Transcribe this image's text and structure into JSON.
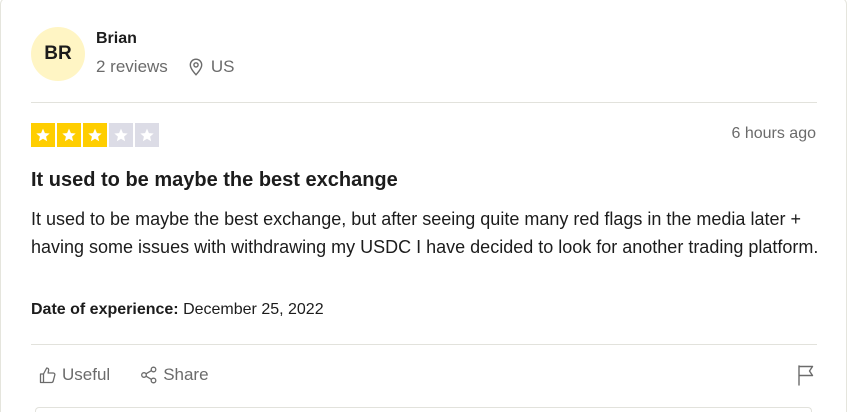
{
  "reviewer": {
    "initials": "BR",
    "name": "Brian",
    "reviews_count": "2 reviews",
    "country": "US",
    "avatar_color": "#fff5c4"
  },
  "review": {
    "rating": 3,
    "rating_max": 5,
    "star_on_color": "#ffce00",
    "star_off_color": "#dcdce6",
    "time_ago": "6 hours ago",
    "title": "It used to be maybe the best exchange",
    "body": "It used to be maybe the best exchange, but after seeing quite many red flags in the media later + having some issues with withdrawing my USDC I have decided to look for another trading platform.",
    "date_label": "Date of experience:",
    "date_value": "December 25, 2022"
  },
  "actions": {
    "useful_label": "Useful",
    "share_label": "Share",
    "useful_icon": "thumbs-up-icon",
    "share_icon": "share-icon",
    "flag_icon": "flag-icon",
    "location_icon": "location-pin-icon"
  }
}
